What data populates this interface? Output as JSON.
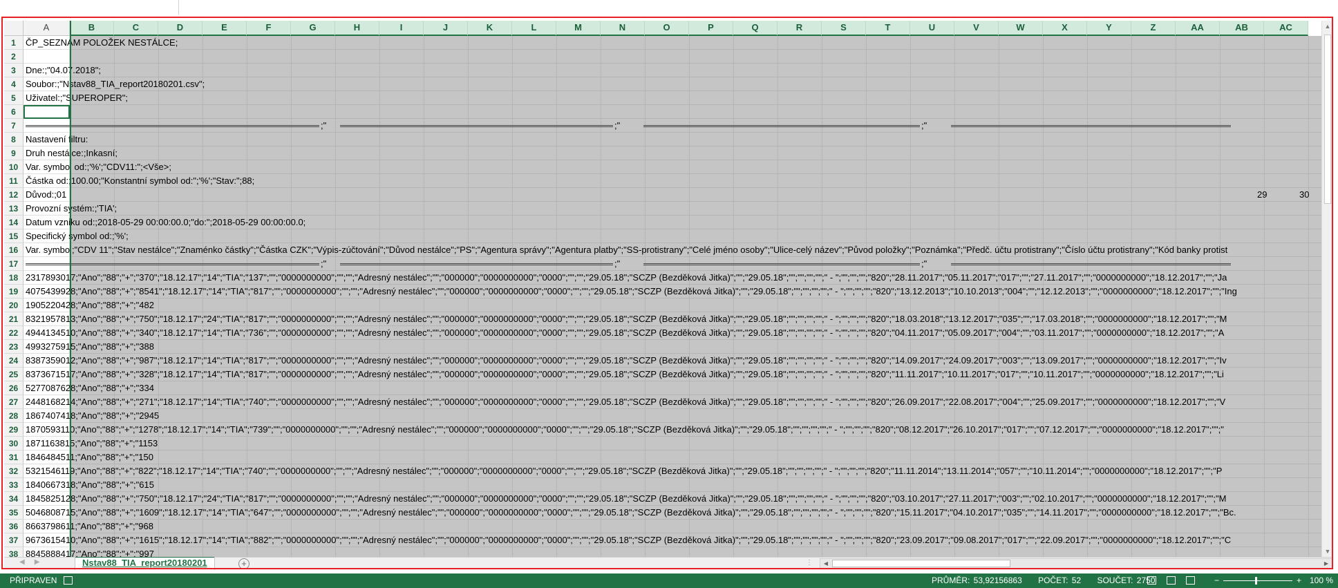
{
  "columns": [
    "A",
    "B",
    "C",
    "D",
    "E",
    "F",
    "G",
    "H",
    "I",
    "J",
    "K",
    "L",
    "M",
    "N",
    "O",
    "P",
    "Q",
    "R",
    "S",
    "T",
    "U",
    "V",
    "W",
    "X",
    "Y",
    "Z",
    "AA",
    "AB",
    "AC"
  ],
  "rows": [
    {
      "n": "1",
      "t": "ČP_SEZNAM POLOŽEK NESTÁLCE;"
    },
    {
      "n": "2",
      "t": ""
    },
    {
      "n": "3",
      "t": "Dne:;\"04.07.2018\";"
    },
    {
      "n": "4",
      "t": "Soubor:;\"Nstav88_TIA_report20180201.csv\";"
    },
    {
      "n": "5",
      "t": "Uživatel:;\"SUPEROPER\";"
    },
    {
      "n": "6",
      "t": ""
    },
    {
      "n": "7",
      "t": ""
    },
    {
      "n": "8",
      "t": "Nastavení filtru:"
    },
    {
      "n": "9",
      "t": "Druh nestálce:;Inkasní;"
    },
    {
      "n": "10",
      "t": "Var. symbol od:;'%';\"CDV11:\";<Vše>;"
    },
    {
      "n": "11",
      "t": "Částka od:;100.00;\"Konstantní symbol od:\";'%';\"Stav:\";88;"
    },
    {
      "n": "12",
      "t": "Důvod:;01"
    },
    {
      "n": "13",
      "t": "Provozní systém:;'TIA';"
    },
    {
      "n": "14",
      "t": "Datum vzniku od:;2018-05-29 00:00:00.0;\"do:\";2018-05-29 00:00:00.0;"
    },
    {
      "n": "15",
      "t": "Specifický symbol od:;'%';"
    },
    {
      "n": "16",
      "t": "Var. symbol;\"CDV 11\";\"Stav nestálce\";\"Znaménko částky\";\"Částka CZK\";\"Výpis-zúčtování\";\"Důvod nestálce\";\"PS\";\"Agentura správy\";\"Agentura platby\";\"SS-protistrany\";\"Celé jméno osoby\";\"Ulice-celý název\";\"Původ položky\";\"Poznámka\";\"Předč. účtu protistrany\";\"Číslo účtu protistrany\";\"Kód banky protist"
    },
    {
      "n": "17",
      "t": ""
    },
    {
      "n": "18",
      "t": "2317893017;\"Ano\";\"88\";\"+\";\"370\";\"18.12.17\";\"14\";\"TIA\";\"137\";\"\";\"0000000000\";\"\";\"\";\"Adresný nestálec\";\"\";\"000000\";\"0000000000\";\"0000\";\"\";\"\";\"29.05.18\";\"SCZP (Bezděková Jitka)\";\"\";\"29.05.18\";\"\";\"\";\"\";\"\";\" - \";\"\";\"\";\"\";\"820\";\"28.11.2017\";\"05.11.2017\";\"017\";\"\";\"27.11.2017\";\"\";\"0000000000\";\"18.12.2017\";\"\";\"Ja"
    },
    {
      "n": "19",
      "t": "4075439928;\"Ano\";\"88\";\"+\";\"8541\";\"18.12.17\";\"14\";\"TIA\";\"817\";\"\";\"0000000000\";\"\";\"\";\"Adresný nestálec\";\"\";\"000000\";\"0000000000\";\"0000\";\"\";\"\";\"29.05.18\";\"SCZP (Bezděková Jitka)\";\"\";\"29.05.18\";\"\";\"\";\"\";\"\";\" - \";\"\";\"\";\"\";\"820\";\"13.12.2013\";\"10.10.2013\";\"004\";\"\";\"12.12.2013\";\"\";\"0000000000\";\"18.12.2017\";\"\";\"Ing"
    },
    {
      "n": "20",
      "t": "1905220428;\"Ano\";\"88\";\"+\";\"482"
    },
    {
      "n": "21",
      "t": "8321957813;\"Ano\";\"88\";\"+\";\"750\";\"18.12.17\";\"24\";\"TIA\";\"817\";\"\";\"0000000000\";\"\";\"\";\"Adresný nestálec\";\"\";\"000000\";\"0000000000\";\"0000\";\"\";\"\";\"29.05.18\";\"SCZP (Bezděková Jitka)\";\"\";\"29.05.18\";\"\";\"\";\"\";\"\";\" - \";\"\";\"\";\"\";\"820\";\"18.03.2018\";\"13.12.2017\";\"035\";\"\";\"17.03.2018\";\"\";\"0000000000\";\"18.12.2017\";\"\";\"M"
    },
    {
      "n": "22",
      "t": "4944134510;\"Ano\";\"88\";\"+\";\"340\";\"18.12.17\";\"14\";\"TIA\";\"736\";\"\";\"0000000000\";\"\";\"\";\"Adresný nestálec\";\"\";\"000000\";\"0000000000\";\"0000\";\"\";\"\";\"29.05.18\";\"SCZP (Bezděková Jitka)\";\"\";\"29.05.18\";\"\";\"\";\"\";\"\";\" - \";\"\";\"\";\"\";\"820\";\"04.11.2017\";\"05.09.2017\";\"004\";\"\";\"03.11.2017\";\"\";\"0000000000\";\"18.12.2017\";\"\";\"A"
    },
    {
      "n": "23",
      "t": "4993275915;\"Ano\";\"88\";\"+\";\"388"
    },
    {
      "n": "24",
      "t": "8387359012;\"Ano\";\"88\";\"+\";\"987\";\"18.12.17\";\"14\";\"TIA\";\"817\";\"\";\"0000000000\";\"\";\"\";\"Adresný nestálec\";\"\";\"000000\";\"0000000000\";\"0000\";\"\";\"\";\"29.05.18\";\"SCZP (Bezděková Jitka)\";\"\";\"29.05.18\";\"\";\"\";\"\";\"\";\" - \";\"\";\"\";\"\";\"820\";\"14.09.2017\";\"24.09.2017\";\"003\";\"\";\"13.09.2017\";\"\";\"0000000000\";\"18.12.2017\";\"\";\"Iv"
    },
    {
      "n": "25",
      "t": "8373671517;\"Ano\";\"88\";\"+\";\"328\";\"18.12.17\";\"14\";\"TIA\";\"817\";\"\";\"0000000000\";\"\";\"\";\"Adresný nestálec\";\"\";\"000000\";\"0000000000\";\"0000\";\"\";\"\";\"29.05.18\";\"SCZP (Bezděková Jitka)\";\"\";\"29.05.18\";\"\";\"\";\"\";\"\";\" - \";\"\";\"\";\"\";\"820\";\"11.11.2017\";\"10.11.2017\";\"017\";\"\";\"10.11.2017\";\"\";\"0000000000\";\"18.12.2017\";\"\";\"Li"
    },
    {
      "n": "26",
      "t": "5277087628;\"Ano\";\"88\";\"+\";\"334"
    },
    {
      "n": "27",
      "t": "2448168214;\"Ano\";\"88\";\"+\";\"271\";\"18.12.17\";\"14\";\"TIA\";\"740\";\"\";\"0000000000\";\"\";\"\";\"Adresný nestálec\";\"\";\"000000\";\"0000000000\";\"0000\";\"\";\"\";\"29.05.18\";\"SCZP (Bezděková Jitka)\";\"\";\"29.05.18\";\"\";\"\";\"\";\"\";\" - \";\"\";\"\";\"\";\"820\";\"26.09.2017\";\"22.08.2017\";\"004\";\"\";\"25.09.2017\";\"\";\"0000000000\";\"18.12.2017\";\"\";\"V"
    },
    {
      "n": "28",
      "t": "1867407418;\"Ano\";\"88\";\"+\";\"2945"
    },
    {
      "n": "29",
      "t": "1870593110;\"Ano\";\"88\";\"+\";\"1278\";\"18.12.17\";\"14\";\"TIA\";\"739\";\"\";\"0000000000\";\"\";\"\";\"Adresný nestálec\";\"\";\"000000\";\"0000000000\";\"0000\";\"\";\"\";\"29.05.18\";\"SCZP (Bezděková Jitka)\";\"\";\"29.05.18\";\"\";\"\";\"\";\"\";\" - \";\"\";\"\";\"\";\"820\";\"08.12.2017\";\"26.10.2017\";\"017\";\"\";\"07.12.2017\";\"\";\"0000000000\";\"18.12.2017\";\"\";\""
    },
    {
      "n": "30",
      "t": "1871163815;\"Ano\";\"88\";\"+\";\"1153"
    },
    {
      "n": "31",
      "t": "1846484511;\"Ano\";\"88\";\"+\";\"150"
    },
    {
      "n": "32",
      "t": "5321546119;\"Ano\";\"88\";\"+\";\"822\";\"18.12.17\";\"14\";\"TIA\";\"740\";\"\";\"0000000000\";\"\";\"\";\"Adresný nestálec\";\"\";\"000000\";\"0000000000\";\"0000\";\"\";\"\";\"29.05.18\";\"SCZP (Bezděková Jitka)\";\"\";\"29.05.18\";\"\";\"\";\"\";\"\";\" - \";\"\";\"\";\"\";\"820\";\"11.11.2014\";\"13.11.2014\";\"057\";\"\";\"10.11.2014\";\"\";\"0000000000\";\"18.12.2017\";\"\";\"P"
    },
    {
      "n": "33",
      "t": "1840667318;\"Ano\";\"88\";\"+\";\"615"
    },
    {
      "n": "34",
      "t": "1845825128;\"Ano\";\"88\";\"+\";\"750\";\"18.12.17\";\"24\";\"TIA\";\"817\";\"\";\"0000000000\";\"\";\"\";\"Adresný nestálec\";\"\";\"000000\";\"0000000000\";\"0000\";\"\";\"\";\"29.05.18\";\"SCZP (Bezděková Jitka)\";\"\";\"29.05.18\";\"\";\"\";\"\";\"\";\" - \";\"\";\"\";\"\";\"820\";\"03.10.2017\";\"27.11.2017\";\"003\";\"\";\"02.10.2017\";\"\";\"0000000000\";\"18.12.2017\";\"\";\"M"
    },
    {
      "n": "35",
      "t": "5046808715;\"Ano\";\"88\";\"+\";\"1609\";\"18.12.17\";\"14\";\"TIA\";\"647\";\"\";\"0000000000\";\"\";\"\";\"Adresný nestálec\";\"\";\"000000\";\"0000000000\";\"0000\";\"\";\"\";\"29.05.18\";\"SCZP (Bezděková Jitka)\";\"\";\"29.05.18\";\"\";\"\";\"\";\"\";\" - \";\"\";\"\";\"\";\"820\";\"15.11.2017\";\"04.10.2017\";\"035\";\"\";\"14.11.2017\";\"\";\"0000000000\";\"18.12.2017\";\"\";\"Bc."
    },
    {
      "n": "36",
      "t": "8663798611;\"Ano\";\"88\";\"+\";\"968"
    },
    {
      "n": "37",
      "t": "9673615410;\"Ano\";\"88\";\"+\";\"1615\";\"18.12.17\";\"14\";\"TIA\";\"882\";\"\";\"0000000000\";\"\";\"\";\"Adresný nestálec\";\"\";\"000000\";\"0000000000\";\"0000\";\"\";\"\";\"29.05.18\";\"SCZP (Bezděková Jitka)\";\"\";\"29.05.18\";\"\";\"\";\"\";\"\";\" - \";\"\";\"\";\"\";\"820\";\"23.09.2017\";\"09.08.2017\";\"017\";\"\";\"22.09.2017\";\"\";\"0000000000\";\"18.12.2017\";\"\";\"C"
    },
    {
      "n": "38",
      "t": "8845888417;\"Ano\";\"88\";\"+\";\"997"
    }
  ],
  "row12_extra": {
    "ab": "29",
    "ac": "30"
  },
  "separator_quote": ";\"",
  "sheet_tab": "Nstav88_TIA_report20180201",
  "status": {
    "ready": "PŘIPRAVEN",
    "average": "PRŮMĚR: 53,92156863",
    "count": "POČET: 52",
    "sum": "SOUČET: 2750",
    "zoom": "100 %"
  },
  "colors": {
    "accent": "#217346",
    "frame": "#e81e25",
    "selection": "#c5c5c5"
  }
}
